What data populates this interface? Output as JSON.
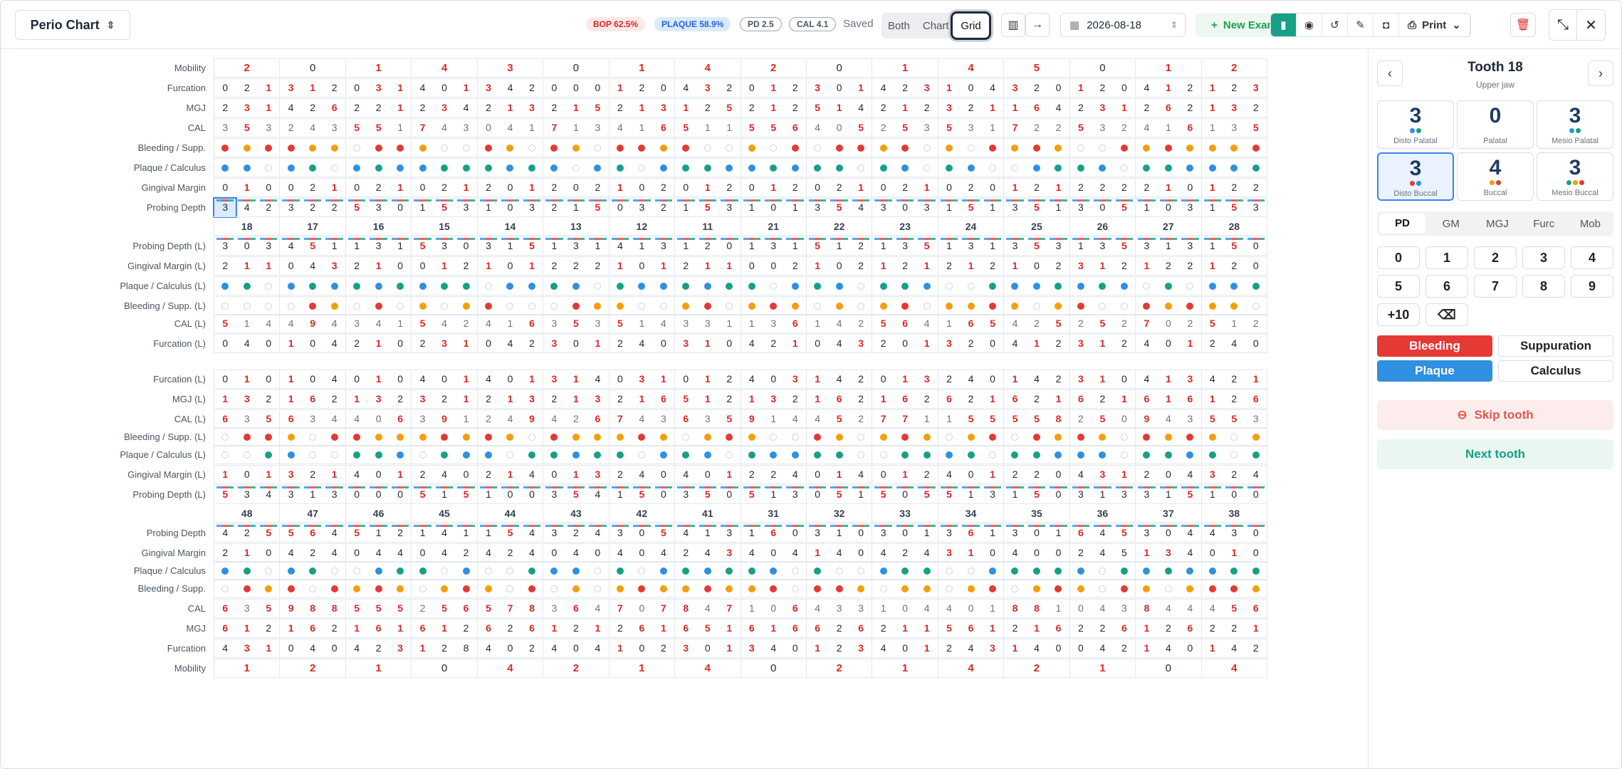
{
  "header": {
    "title": "Perio Chart",
    "bop": "BOP 62.5%",
    "plaque": "PLAQUE 58.9%",
    "pd": "PD 2.5",
    "cal": "CAL 4.1",
    "saved": "Saved",
    "view_both": "Both",
    "view_chart": "Chart",
    "view_grid": "Grid",
    "date": "2026-08-18",
    "new_exam": "New Exam",
    "print": "Print",
    "colors": {
      "accent": "#16a085",
      "bop": "#dc2626",
      "plaque": "#2563eb"
    }
  },
  "labels": {
    "upper_buccal": [
      "Mobility",
      "Furcation",
      "MGJ",
      "CAL",
      "Bleeding / Supp.",
      "Plaque / Calculus",
      "Gingival Margin",
      "Probing Depth"
    ],
    "upper_lingual": [
      "Probing Depth (L)",
      "Gingival Margin (L)",
      "Plaque / Calculus (L)",
      "Bleeding / Supp. (L)",
      "CAL (L)",
      "Furcation (L)"
    ],
    "lower_lingual": [
      "Furcation (L)",
      "MGJ (L)",
      "CAL (L)",
      "Bleeding / Supp. (L)",
      "Plaque / Calculus (L)",
      "Gingival Margin (L)",
      "Probing Depth (L)"
    ],
    "lower_buccal": [
      "Probing Depth",
      "Gingival Margin",
      "Plaque / Calculus",
      "Bleeding / Supp.",
      "CAL",
      "MGJ",
      "Furcation",
      "Mobility"
    ]
  },
  "upper_teeth": [
    "18",
    "17",
    "16",
    "15",
    "14",
    "13",
    "12",
    "11",
    "21",
    "22",
    "23",
    "24",
    "25",
    "26",
    "27",
    "28"
  ],
  "lower_teeth": [
    "48",
    "47",
    "46",
    "45",
    "44",
    "43",
    "42",
    "41",
    "31",
    "32",
    "33",
    "34",
    "35",
    "36",
    "37",
    "38"
  ],
  "upper": {
    "mobility": [
      "2",
      "0",
      "1",
      "4",
      "3",
      "0",
      "1",
      "4",
      "2",
      "0",
      "1",
      "4",
      "5",
      "0",
      "1",
      "2"
    ],
    "furcation": "021312031401342000120432012301423104320120412123",
    "mgj": "231426221234213215213125212514212321164231262132",
    "cal": "353243551743041713416511556405253531722532416135",
    "pd": "342322530153103215032153101354303151351305103153",
    "gm": "010021021021201202102012012021021020121222210122",
    "bleed": "rorrooerroeeroeroerroreeoererroreoeroroeeroroooro",
    "plaque": "bbebgebgbbgggbgbebgebggbbgbggegbegbeebggbeggbbbgeeg",
    "pd_l": "303451131530315131413120131512135131353135313150414",
    "gm_l": "211043210012101222101211002102121212102312122120011",
    "plaque_l": "bgebgbgbgbggebbgbegbbgbggebgbeggbeegbbgbgbegebbgbbg",
    "bleed_l": "eeeeroereoeoreeerooeeoreoroeoeoreooroeoreerorooeoo",
    "cal_l": "514494341542416353514331136142564165425252702512",
    "furcation_l": "040104210231042301240310421043201320412312401240"
  },
  "lower": {
    "furcation_l": "010104010401401314031012403142013240142310413421",
    "mgj_l": "132162132321213213216512132162162621621621616126",
    "cal_l": "635634406391249426743635914452771155558250943553",
    "bleed_l": "erroerrooororoeroooroeoroeeroeoroeoreroroeroroeorr",
    "plaque_l": "eegbeeggbegbbeggbggebgbegbbggeeggbgeggbbbeggbgegbbg",
    "gm_l": "101321401240214013240401224014012401220431204324010",
    "pd_l": "534313000515100354150350513051505513150313315100131",
    "pd": "425564512141154324305413160310301361301645304430130",
    "gm": "210424044042424040404243404140424310400245134010521",
    "plaque": "bgebgeebggebeegbbegebgbggbegeebggeebgggbegbgbbggebg",
    "bleed": "eroreroroeoroereoeorooroorerroeooeoreoroeroeorrorore",
    "cal": "635988555256578364707847106433104401881043844456651",
    "mgj": "612162161612626121261651616626211561216226126221621",
    "furcation": "431040423128402404102301340123401243140042140142314",
    "mobility": [
      "1",
      "2",
      "1",
      "0",
      "4",
      "2",
      "1",
      "4",
      "0",
      "2",
      "1",
      "4",
      "2",
      "1",
      "0",
      "4"
    ]
  },
  "side": {
    "tooth": "Tooth 18",
    "jaw": "Upper jaw",
    "sites": [
      {
        "label": "Disto Palatal",
        "value": "3"
      },
      {
        "label": "Palatal",
        "value": "0"
      },
      {
        "label": "Mesio Palatal",
        "value": "3"
      },
      {
        "label": "Disto Buccal",
        "value": "3"
      },
      {
        "label": "Buccal",
        "value": "4"
      },
      {
        "label": "Mesio Buccal",
        "value": "3"
      }
    ],
    "tabs": [
      "PD",
      "GM",
      "MGJ",
      "Furc",
      "Mob"
    ],
    "keys": [
      "0",
      "1",
      "2",
      "3",
      "4",
      "5",
      "6",
      "7",
      "8",
      "9",
      "+10",
      "⌫"
    ],
    "bleeding": "Bleeding",
    "suppuration": "Suppuration",
    "plaque": "Plaque",
    "calculus": "Calculus",
    "skip": "Skip tooth",
    "next": "Next tooth"
  }
}
